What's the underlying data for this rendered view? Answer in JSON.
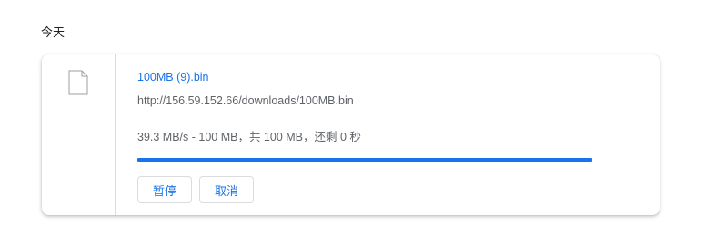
{
  "section": {
    "title": "今天"
  },
  "download": {
    "file_icon": "file-icon",
    "file_name": "100MB (9).bin",
    "url": "http://156.59.152.66/downloads/100MB.bin",
    "status": "39.3 MB/s - 100 MB，共 100 MB，还剩 0 秒",
    "progress": 1.0,
    "pause_label": "暂停",
    "cancel_label": "取消"
  },
  "colors": {
    "accent": "#1a73e8",
    "text_secondary": "#5f6368",
    "border": "#dadce0"
  }
}
